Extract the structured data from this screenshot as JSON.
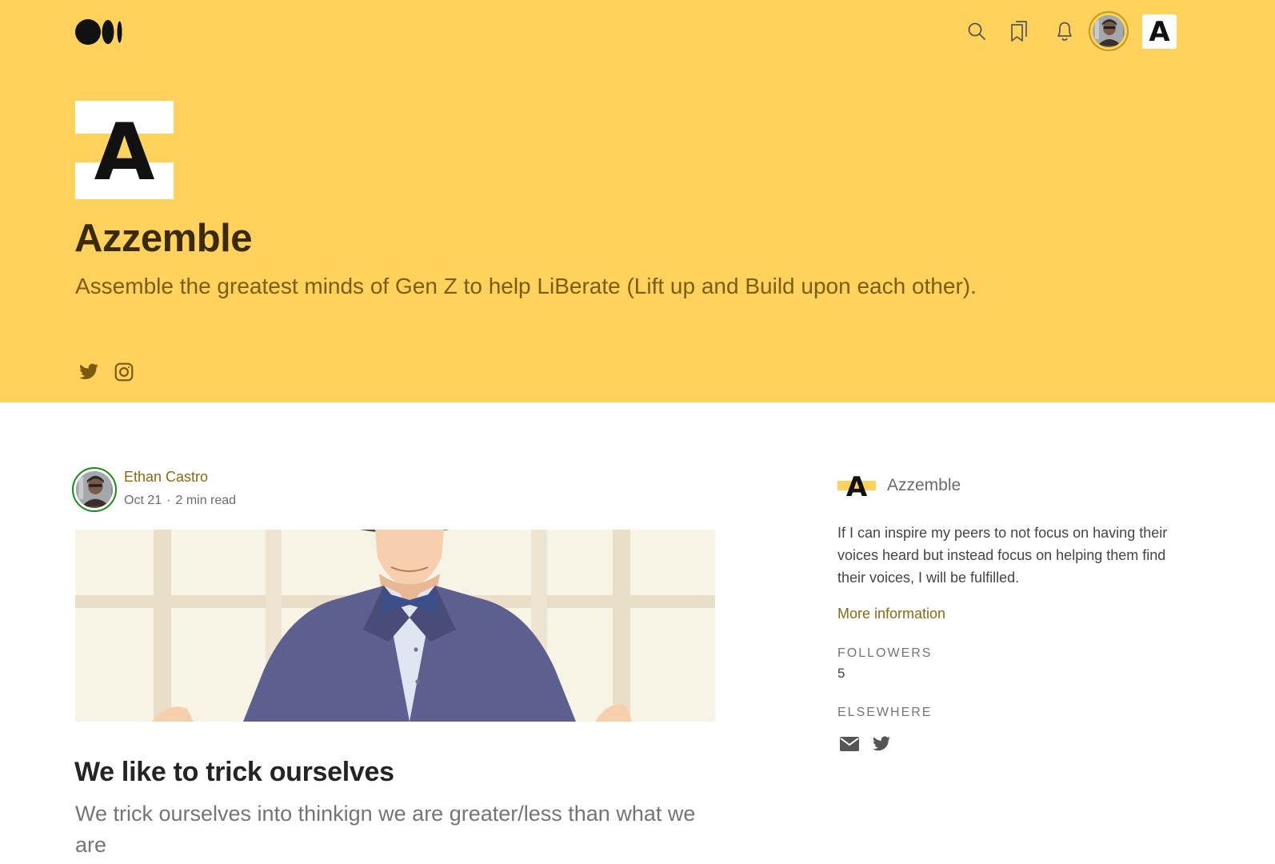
{
  "publication": {
    "name": "Azzemble",
    "tagline": "Assemble the greatest minds of Gen Z to help LiBerate (Lift up and Build upon each other).",
    "logo_letter": "A",
    "brand_color": "#ffd25e",
    "social_icons": [
      "twitter-icon",
      "instagram-icon"
    ]
  },
  "topbar": {
    "icons": [
      "medium-logo",
      "search-icon",
      "bookmarks-icon",
      "bell-icon",
      "user-avatar",
      "publication-avatar"
    ],
    "publication_letter": "A"
  },
  "article": {
    "author": "Ethan Castro",
    "date": "Oct 21",
    "separator": "·",
    "read_time": "2 min read",
    "title": "We like to trick ourselves",
    "subtitle": "We trick ourselves into thinkign we are greater/less than what we are"
  },
  "sidebar": {
    "name": "Azzemble",
    "logo_letter": "A",
    "description": "If I can inspire my peers to not focus on having their voices heard but instead focus on helping them find their voices, I will be fulfilled.",
    "more_link": "More information",
    "followers_label": "FOLLOWERS",
    "followers_count": "5",
    "elsewhere_label": "ELSEWHERE",
    "elsewhere_icons": [
      "mail-icon",
      "twitter-icon"
    ]
  },
  "colors": {
    "hero_background": "#ffd25e",
    "title_dark": "#3a2a06",
    "tagline": "#7c5c0e",
    "link_gold": "#8a6a12",
    "author_ring": "#1a8917"
  }
}
